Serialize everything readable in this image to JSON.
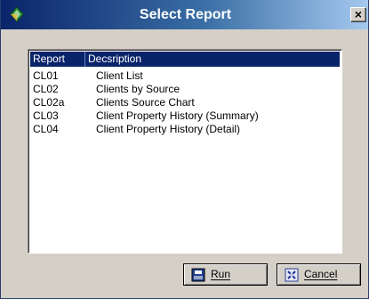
{
  "window": {
    "title": "Select Report",
    "close_label": "×"
  },
  "list": {
    "columns": [
      "Report",
      "Decsription"
    ],
    "rows": [
      {
        "code": "CL01",
        "description": "Client List"
      },
      {
        "code": "CL02",
        "description": "Clients by Source"
      },
      {
        "code": "CL02a",
        "description": "Clients Source Chart"
      },
      {
        "code": "CL03",
        "description": "Client Property History (Summary)"
      },
      {
        "code": "CL04",
        "description": "Client Property History (Detail)"
      }
    ]
  },
  "buttons": {
    "run_label": "Run",
    "cancel_label": "Cancel"
  },
  "icons": {
    "app": "app-leaf-icon",
    "run": "printer-icon",
    "cancel": "cancel-icon"
  },
  "colors": {
    "titlebar_start": "#0a246a",
    "titlebar_end": "#a6caf0",
    "header_bg": "#0a246a"
  }
}
